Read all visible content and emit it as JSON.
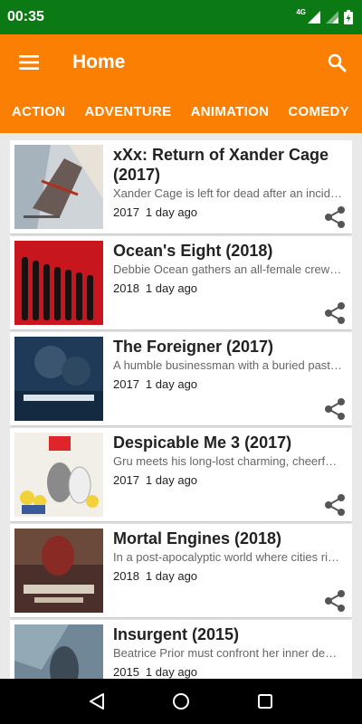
{
  "status_bar": {
    "time": "00:35",
    "network_label": "4G"
  },
  "app_bar": {
    "title": "Home",
    "menu_icon": "hamburger-menu-icon",
    "search_icon": "search-icon",
    "color": "#fa7f02"
  },
  "tabs": [
    {
      "label": "ACTION"
    },
    {
      "label": "ADVENTURE"
    },
    {
      "label": "ANIMATION"
    },
    {
      "label": "COMEDY"
    }
  ],
  "movies": [
    {
      "title": "xXx: Return of Xander Cage (2017)",
      "description": "Xander Cage is left for dead after an incident, though he secretly returns to action",
      "year": "2017",
      "posted": "1 day ago"
    },
    {
      "title": "Ocean's Eight (2018)",
      "description": "Debbie Ocean gathers an all-female crew to attempt an impossible heist at New York",
      "year": "2018",
      "posted": "1 day ago"
    },
    {
      "title": "The Foreigner (2017)",
      "description": "A humble businessman with a buried past seeks justice when his daughter is killed in",
      "year": "2017",
      "posted": "1 day ago"
    },
    {
      "title": "Despicable Me 3 (2017)",
      "description": "Gru meets his long-lost charming, cheerful, and more successful twin brother Dru who",
      "year": "2017",
      "posted": "1 day ago"
    },
    {
      "title": "Mortal Engines (2018)",
      "description": "In a post-apocalyptic world where cities ride on wheels and consume each other to",
      "year": "2018",
      "posted": "1 day ago"
    },
    {
      "title": "Insurgent (2015)",
      "description": "Beatrice Prior must confront her inner demons and continue her fight against a powerful",
      "year": "2015",
      "posted": "1 day ago"
    }
  ],
  "nav_bar": {
    "back_icon": "back-triangle-icon",
    "home_icon": "home-circle-icon",
    "recents_icon": "recents-square-icon"
  }
}
